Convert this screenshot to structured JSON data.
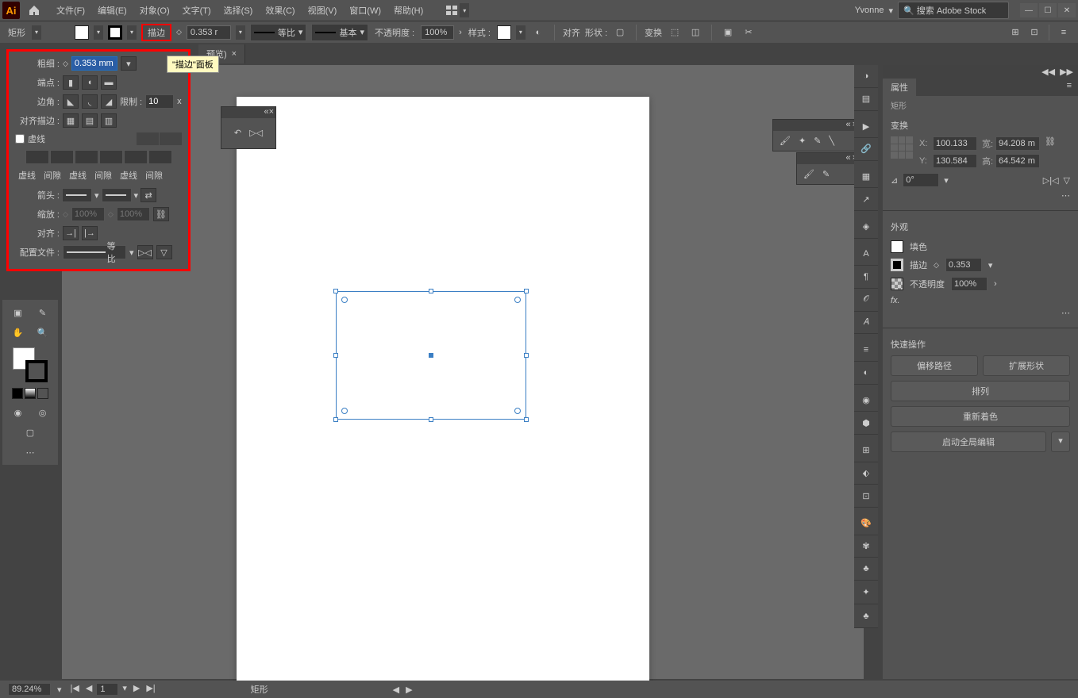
{
  "menu": {
    "file": "文件(F)",
    "edit": "编辑(E)",
    "object": "对象(O)",
    "type": "文字(T)",
    "select": "选择(S)",
    "effect": "效果(C)",
    "view": "视图(V)",
    "window": "窗口(W)",
    "help": "帮助(H)"
  },
  "user": "Yvonne",
  "search_placeholder": "搜索 Adobe Stock",
  "control": {
    "shape": "矩形",
    "stroke_link": "描边",
    "weight": "0.353 r",
    "profile": "等比",
    "brush": "基本",
    "opacity_label": "不透明度 :",
    "opacity": "100%",
    "style_label": "样式 :",
    "align": "对齐",
    "shape2": "形状 :",
    "transform": "变换"
  },
  "doc_tab": "预览)",
  "tooltip": "\"描边\"面板",
  "stroke_panel": {
    "weight_label": "粗细 :",
    "weight": "0.353 mm",
    "cap_label": "端点 :",
    "corner_label": "边角 :",
    "limit_label": "限制 :",
    "limit": "10",
    "align_label": "对齐描边 :",
    "dash_label": "虚线",
    "dash_cols": [
      "虚线",
      "间隙",
      "虚线",
      "间隙",
      "虚线",
      "间隙"
    ],
    "arrow_label": "箭头 :",
    "scale_label": "缩放 :",
    "scale1": "100%",
    "scale2": "100%",
    "align2_label": "对齐 :",
    "profile_label": "配置文件 :",
    "profile": "等比"
  },
  "props": {
    "title": "属性",
    "subtitle": "矩形",
    "transform": "变换",
    "x_label": "X:",
    "x": "100.133",
    "w_label": "宽:",
    "w": "94.208 m",
    "y_label": "Y:",
    "y": "130.584",
    "h_label": "高:",
    "h": "64.542 m",
    "angle": "0°",
    "appearance": "外观",
    "fill": "填色",
    "stroke": "描边",
    "stroke_val": "0.353",
    "opacity": "不透明度",
    "opacity_val": "100%",
    "fx": "fx.",
    "quick": "快速操作",
    "b1": "偏移路径",
    "b2": "扩展形状",
    "b3": "排列",
    "b4": "重新着色",
    "b5": "启动全局编辑"
  },
  "status": {
    "zoom": "89.24%",
    "page": "1",
    "sel": "矩形"
  }
}
